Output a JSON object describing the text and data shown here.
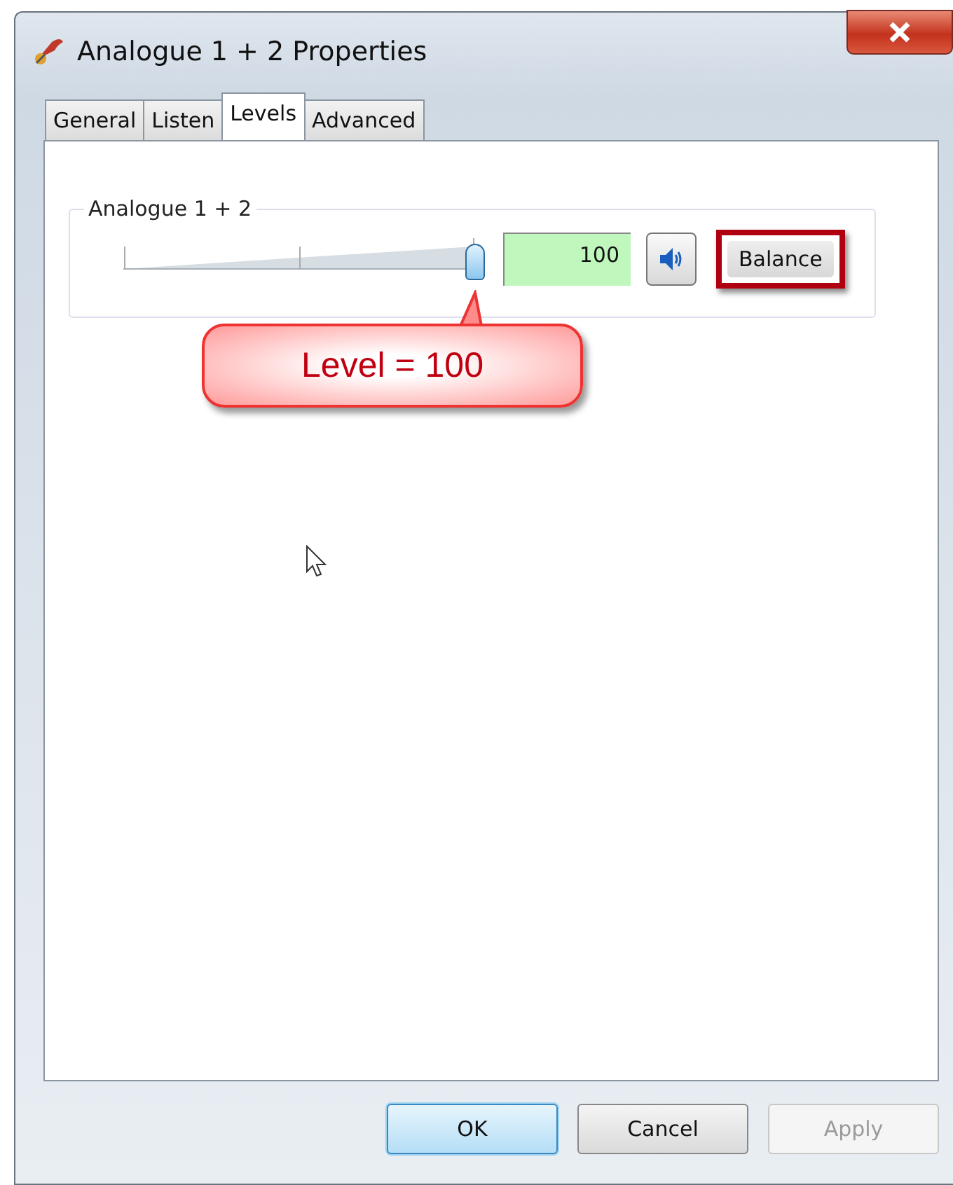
{
  "window": {
    "title": "Analogue 1 + 2 Properties"
  },
  "tabs": [
    {
      "label": "General",
      "selected": false
    },
    {
      "label": "Listen",
      "selected": false
    },
    {
      "label": "Levels",
      "selected": true
    },
    {
      "label": "Advanced",
      "selected": false
    }
  ],
  "levels": {
    "group_label": "Analogue 1 + 2",
    "level": 1.0,
    "value": "100",
    "muted": false,
    "balance_button": {
      "label": "Balance",
      "highlighted": true
    }
  },
  "callout": {
    "text": "Level = 100"
  },
  "buttons": [
    {
      "label": "OK",
      "kind": "default",
      "disabled": false
    },
    {
      "label": "Cancel",
      "kind": "normal",
      "disabled": false
    },
    {
      "label": "Apply",
      "kind": "normal",
      "disabled": true
    }
  ]
}
